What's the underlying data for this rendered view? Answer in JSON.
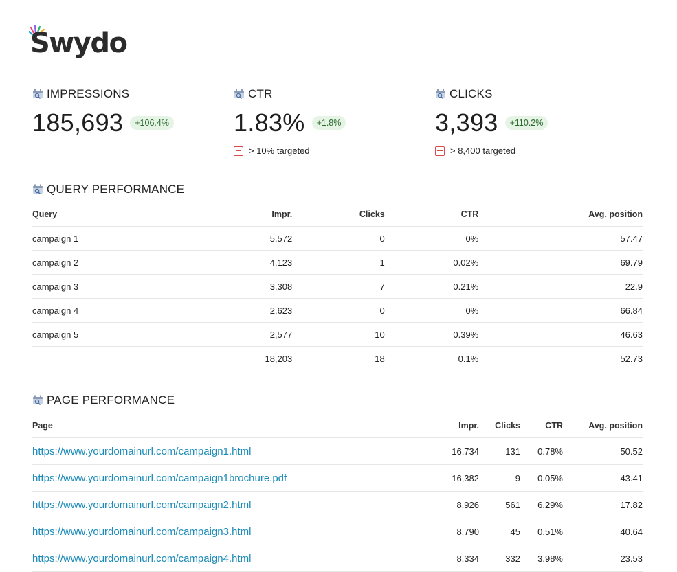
{
  "brand": {
    "name": "Swydo"
  },
  "kpis": [
    {
      "title": "IMPRESSIONS",
      "value": "185,693",
      "change": "+106.4%",
      "target": ""
    },
    {
      "title": "CTR",
      "value": "1.83%",
      "change": "+1.8%",
      "target": "> 10% targeted"
    },
    {
      "title": "CLICKS",
      "value": "3,393",
      "change": "+110.2%",
      "target": "> 8,400 targeted"
    }
  ],
  "query_performance": {
    "title": "QUERY PERFORMANCE",
    "columns": [
      "Query",
      "Impr.",
      "Clicks",
      "CTR",
      "Avg. position"
    ],
    "rows": [
      [
        "campaign 1",
        "5,572",
        "0",
        "0%",
        "57.47"
      ],
      [
        "campaign 2",
        "4,123",
        "1",
        "0.02%",
        "69.79"
      ],
      [
        "campaign 3",
        "3,308",
        "7",
        "0.21%",
        "22.9"
      ],
      [
        "campaign 4",
        "2,623",
        "0",
        "0%",
        "66.84"
      ],
      [
        "campaign 5",
        "2,577",
        "10",
        "0.39%",
        "46.63"
      ]
    ],
    "total": [
      "",
      "18,203",
      "18",
      "0.1%",
      "52.73"
    ]
  },
  "page_performance": {
    "title": "PAGE PERFORMANCE",
    "columns": [
      "Page",
      "Impr.",
      "Clicks",
      "CTR",
      "Avg. position"
    ],
    "rows": [
      [
        "https://www.yourdomainurl.com/campaign1.html",
        "16,734",
        "131",
        "0.78%",
        "50.52"
      ],
      [
        "https://www.yourdomainurl.com/campaign1brochure.pdf",
        "16,382",
        "9",
        "0.05%",
        "43.41"
      ],
      [
        "https://www.yourdomainurl.com/campaign2.html",
        "8,926",
        "561",
        "6.29%",
        "17.82"
      ],
      [
        "https://www.yourdomainurl.com/campaign3.html",
        "8,790",
        "45",
        "0.51%",
        "40.64"
      ],
      [
        "https://www.yourdomainurl.com/campaign4.html",
        "8,334",
        "332",
        "3.98%",
        "23.53"
      ]
    ]
  },
  "icons": {
    "logo_mark": "colorful-sparkle-icon",
    "source": "google-search-console-icon",
    "target": "target-not-met-icon"
  },
  "colors": {
    "badge_bg": "#e6f4e6",
    "badge_text": "#2b6a2e",
    "target_miss": "#d84a4a",
    "link": "#1a8bb8"
  }
}
